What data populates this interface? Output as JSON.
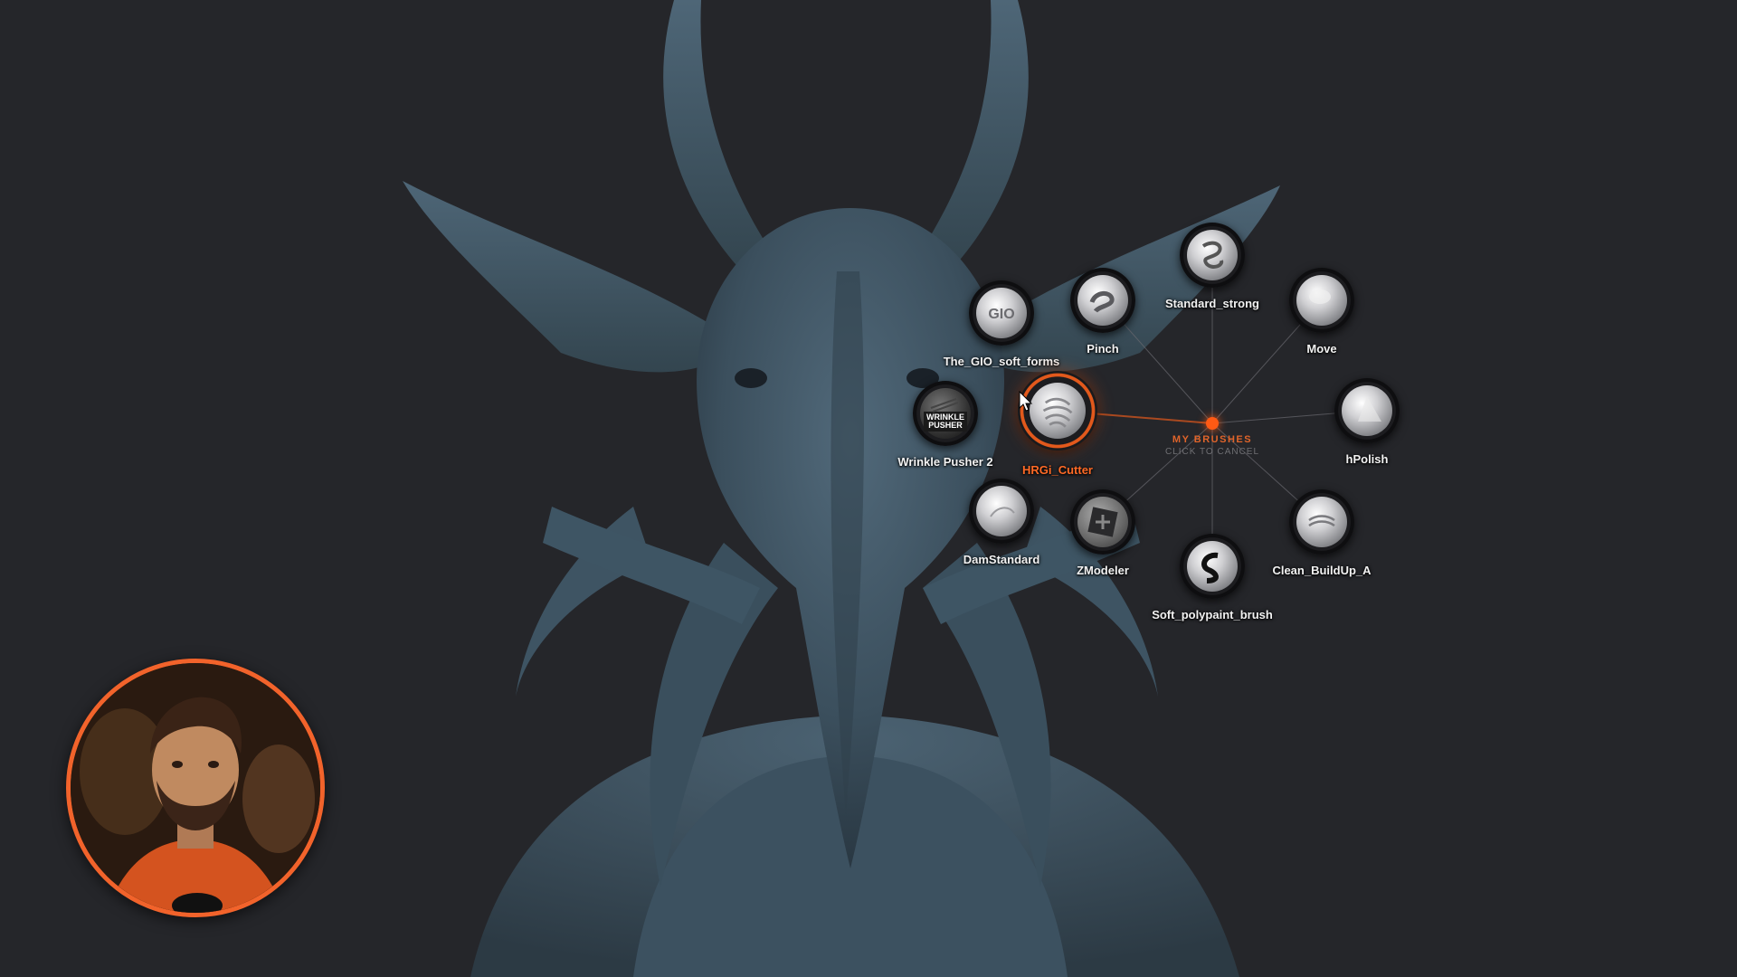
{
  "menu": {
    "title": "MY BRUSHES",
    "subtitle": "CLICK TO CANCEL",
    "accent_color": "#ff6a26",
    "brushes": [
      {
        "id": "standard_strong",
        "label": "Standard_strong",
        "icon": "standard-strong-brush-icon"
      },
      {
        "id": "pinch",
        "label": "Pinch",
        "icon": "pinch-brush-icon"
      },
      {
        "id": "gio_soft_forms",
        "label": "The_GIO_soft_forms",
        "icon": "gio-soft-forms-brush-icon"
      },
      {
        "id": "move",
        "label": "Move",
        "icon": "move-brush-icon"
      },
      {
        "id": "wrinkle_pusher_2",
        "label": "Wrinkle Pusher 2",
        "icon": "wrinkle-pusher-brush-icon",
        "icon_text": "WRINKLE PUSHER"
      },
      {
        "id": "hrgi_cutter",
        "label": "HRGi_Cutter",
        "icon": "hrgi-cutter-brush-icon",
        "selected": true
      },
      {
        "id": "hpolish",
        "label": "hPolish",
        "icon": "hpolish-brush-icon"
      },
      {
        "id": "damstandard",
        "label": "DamStandard",
        "icon": "damstandard-brush-icon"
      },
      {
        "id": "zmodeler",
        "label": "ZModeler",
        "icon": "zmodeler-brush-icon"
      },
      {
        "id": "clean_buildup_a",
        "label": "Clean_BuildUp_A",
        "icon": "clean-buildup-brush-icon"
      },
      {
        "id": "soft_polypaint",
        "label": "Soft_polypaint_brush",
        "icon": "soft-polypaint-brush-icon"
      }
    ]
  }
}
